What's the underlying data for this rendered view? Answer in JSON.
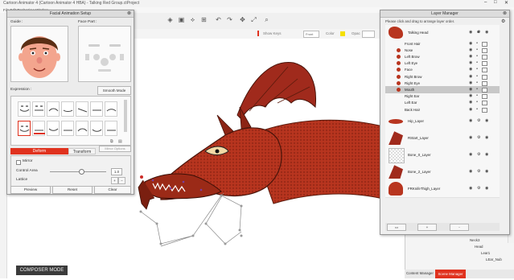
{
  "window": {
    "title": "Cartoon Animator 4 (Cartoon Animator 4 HBA) - Talking Red Group.ctProject",
    "menu": "File  Edit  Tools  View  Window"
  },
  "toolbar": {
    "show_keys_label": "Show Keys",
    "color_label": "Color",
    "opacity_label": "Opac",
    "dropdown_value": "Front"
  },
  "facial_panel": {
    "title": "Facial Animation Setup",
    "guide_label": "Guide :",
    "face_part_label": "Face Part :",
    "expression_label": "Expression :",
    "smooth_mode_label": "Smooth Mode",
    "tabs": [
      "Deform",
      "Transform"
    ],
    "mirror_option_label": "Mirror Options",
    "mirror_label": "Mirror",
    "control_area_label": "Control Area",
    "control_area_value": "1.0",
    "lattice_label": "Lattice",
    "buttons": [
      "Preview",
      "Reset",
      "Clear"
    ]
  },
  "layer_manager": {
    "title": "Layer Manager",
    "hint": "Please click and drag to arrange layer order.",
    "rows": [
      {
        "name": "Talking Head",
        "indent": 0,
        "thumb": "head",
        "selected": false
      },
      {
        "name": "Front Hair",
        "indent": 1,
        "thumb": "none",
        "selected": false
      },
      {
        "name": "Nose",
        "indent": 1,
        "thumb": "red",
        "selected": false
      },
      {
        "name": "Left Brow",
        "indent": 1,
        "thumb": "red",
        "selected": false
      },
      {
        "name": "Left Eye",
        "indent": 1,
        "thumb": "red",
        "selected": false
      },
      {
        "name": "Face",
        "indent": 1,
        "thumb": "red",
        "selected": false
      },
      {
        "name": "Right Brow",
        "indent": 1,
        "thumb": "red",
        "selected": false
      },
      {
        "name": "Right Eye",
        "indent": 1,
        "thumb": "red",
        "selected": false
      },
      {
        "name": "Mouth",
        "indent": 1,
        "thumb": "red",
        "selected": true
      },
      {
        "name": "Right Ear",
        "indent": 1,
        "thumb": "none",
        "selected": false
      },
      {
        "name": "Left Ear",
        "indent": 1,
        "thumb": "none",
        "selected": false
      },
      {
        "name": "Back Hair",
        "indent": 1,
        "thumb": "none",
        "selected": false
      },
      {
        "name": "Hip_Layer",
        "indent": 0,
        "thumb": "red-wide",
        "selected": false
      },
      {
        "name": "RStart_Layer",
        "indent": 0,
        "thumb": "wing",
        "selected": false
      },
      {
        "name": "Bone_0_Layer",
        "indent": 0,
        "thumb": "checker",
        "selected": false
      },
      {
        "name": "Bone_2_Layer",
        "indent": 0,
        "thumb": "wing",
        "selected": false
      },
      {
        "name": "FRKnifeThigh_Layer",
        "indent": 0,
        "thumb": "red-leg",
        "selected": false
      }
    ],
    "footer_buttons": [
      "+",
      "-"
    ]
  },
  "scene_manager": {
    "tree": [
      "Neck3",
      "Head",
      "Lear1",
      "LEar_Nub"
    ]
  },
  "bottom_tabs": [
    "Content Manager",
    "Scene Manager"
  ],
  "composer_mode": "COMPOSER MODE",
  "colors": {
    "accent": "#e0321e",
    "dragon_red": "#b8351f",
    "wing_red": "#a02a1c",
    "panel_bg": "#ececec"
  }
}
